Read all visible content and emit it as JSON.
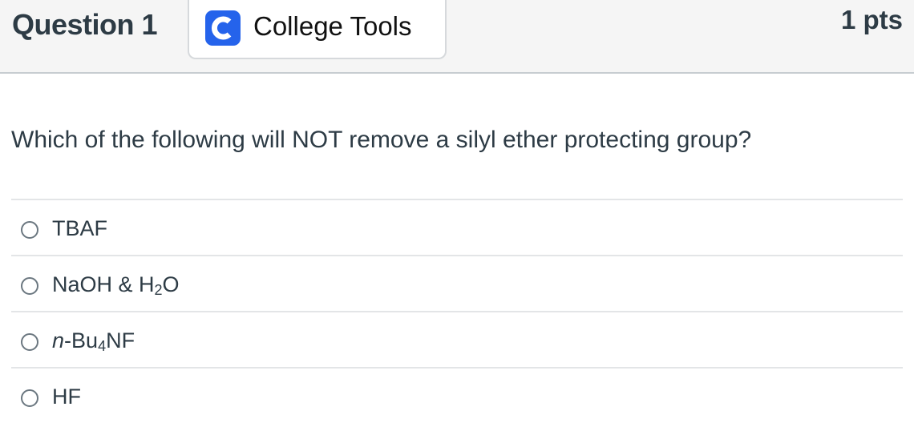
{
  "header": {
    "question_title": "Question 1",
    "tools_label": "College Tools",
    "tools_logo_letter": "C",
    "points": "1 pts"
  },
  "question": {
    "text": "Which of the following will NOT remove a silyl ether protecting group?"
  },
  "answers": [
    {
      "label": "TBAF"
    },
    {
      "label_main": "NaOH & H",
      "label_sub": "2",
      "label_tail": "O"
    },
    {
      "label_italic": "n",
      "label_main": "-Bu",
      "label_sub": "4",
      "label_tail": "NF"
    },
    {
      "label": "HF"
    }
  ],
  "colors": {
    "header_bg": "#f5f5f5",
    "brand_accent": "#2563eb",
    "text": "#2d3b45",
    "divider": "#e3e5e7"
  }
}
